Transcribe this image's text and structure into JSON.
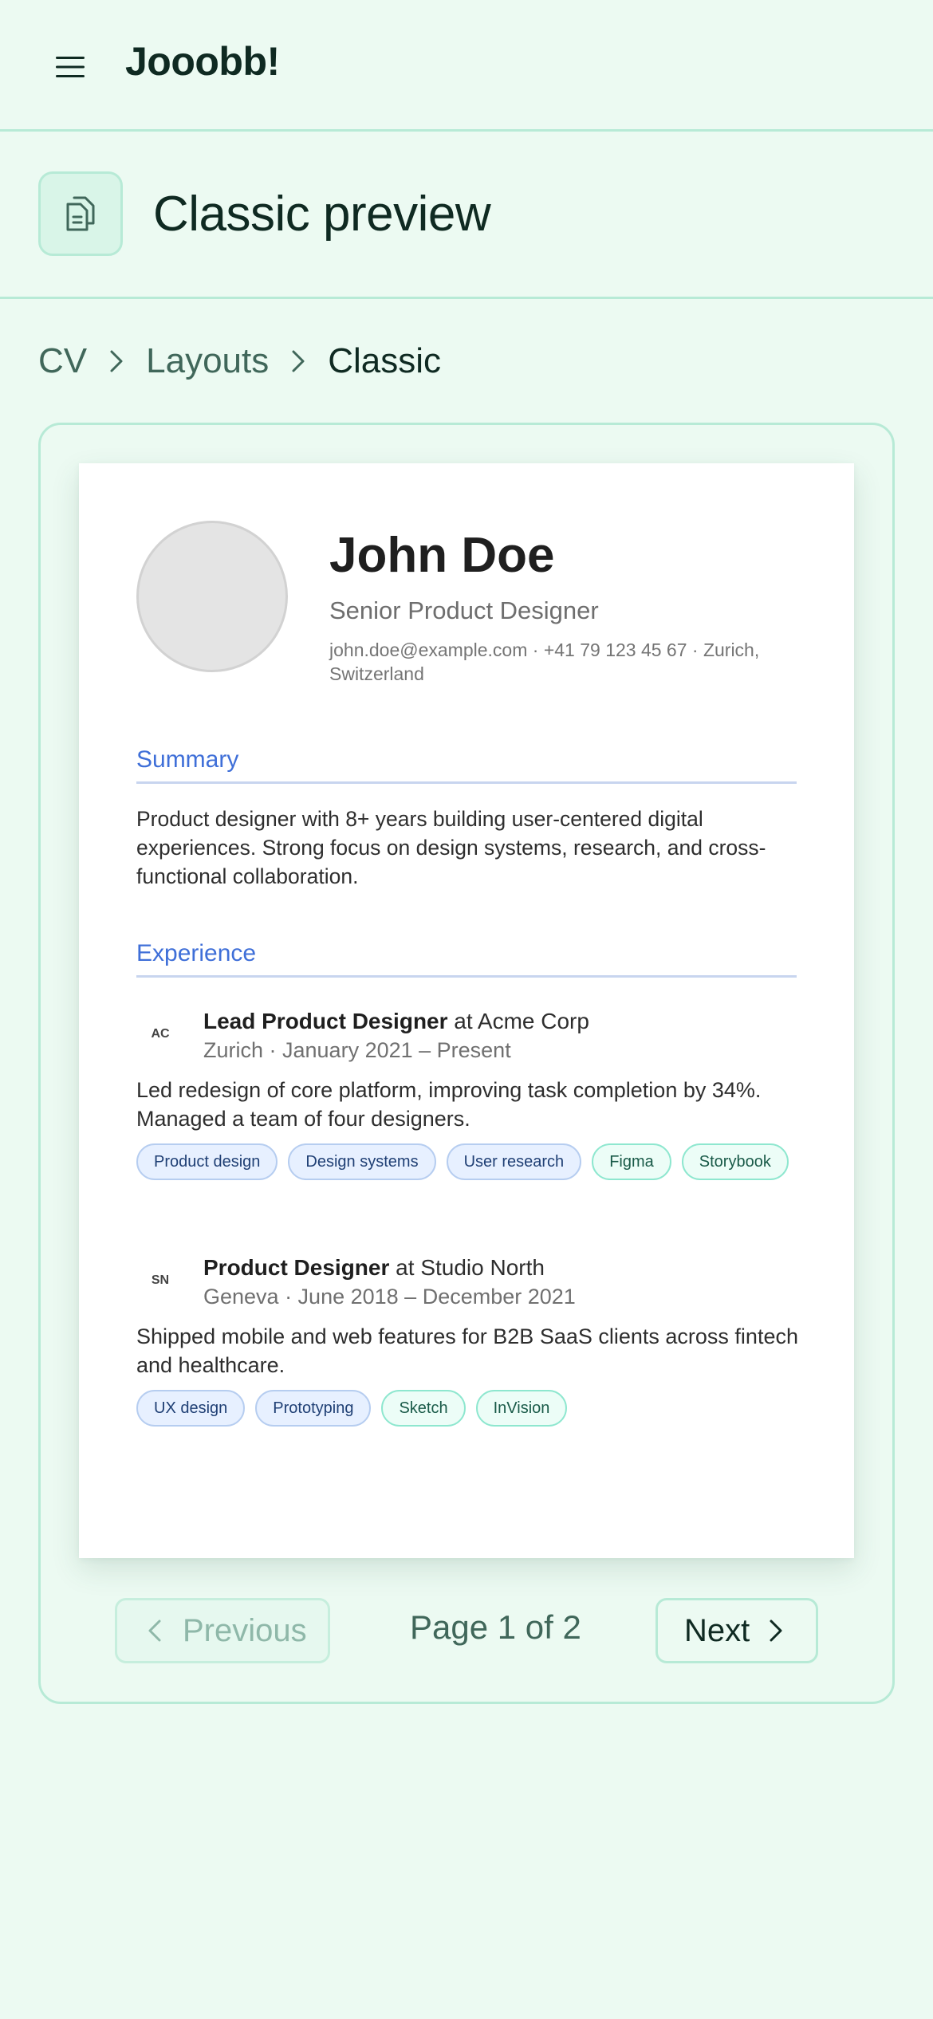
{
  "app": {
    "brand": "Jooobb!"
  },
  "page": {
    "title": "Classic preview"
  },
  "breadcrumb": [
    {
      "label": "CV"
    },
    {
      "label": "Layouts"
    },
    {
      "label": "Classic"
    }
  ],
  "cv": {
    "name": "John Doe",
    "role": "Senior Product Designer",
    "contact": "john.doe@example.com · +41 79 123 45 67 · Zurich, Switzerland",
    "sections": {
      "summary_title": "Summary",
      "summary_text": "Product designer with 8+ years building user-centered digital experiences. Strong focus on design systems, research, and cross-functional collaboration.",
      "experience_title": "Experience"
    },
    "experience": [
      {
        "logo": "AC",
        "title": "Lead Product Designer",
        "connector": "at",
        "company": "Acme Corp",
        "meta": "Zurich · January 2021 – Present",
        "description": "Led redesign of core platform, improving task completion by 34%. Managed a team of four designers.",
        "tags": [
          {
            "label": "Product design",
            "style": "blue"
          },
          {
            "label": "Design systems",
            "style": "blue"
          },
          {
            "label": "User research",
            "style": "blue"
          },
          {
            "label": "Figma",
            "style": "green"
          },
          {
            "label": "Storybook",
            "style": "green"
          }
        ]
      },
      {
        "logo": "SN",
        "title": "Product Designer",
        "connector": "at",
        "company": "Studio North",
        "meta": "Geneva · June 2018 – December 2021",
        "description": "Shipped mobile and web features for B2B SaaS clients across fintech and healthcare.",
        "tags": [
          {
            "label": "UX design",
            "style": "blue"
          },
          {
            "label": "Prototyping",
            "style": "blue"
          },
          {
            "label": "Sketch",
            "style": "green"
          },
          {
            "label": "InVision",
            "style": "green"
          }
        ]
      }
    ]
  },
  "pager": {
    "previous_label": "Previous",
    "next_label": "Next",
    "indicator": "Page 1 of 2",
    "current_page": 1,
    "total_pages": 2,
    "previous_disabled": true
  },
  "icons": {
    "menu": "hamburger-menu-icon",
    "page": "document-copy-icon",
    "separator": "chevron-right-icon",
    "previous": "chevron-left-icon",
    "next": "chevron-right-icon"
  },
  "colors": {
    "background": "#ecfaf2",
    "border": "#b7ead6",
    "accent_blue": "#3f6fd8",
    "text_primary": "#0f2a22",
    "text_muted": "#40675a"
  }
}
